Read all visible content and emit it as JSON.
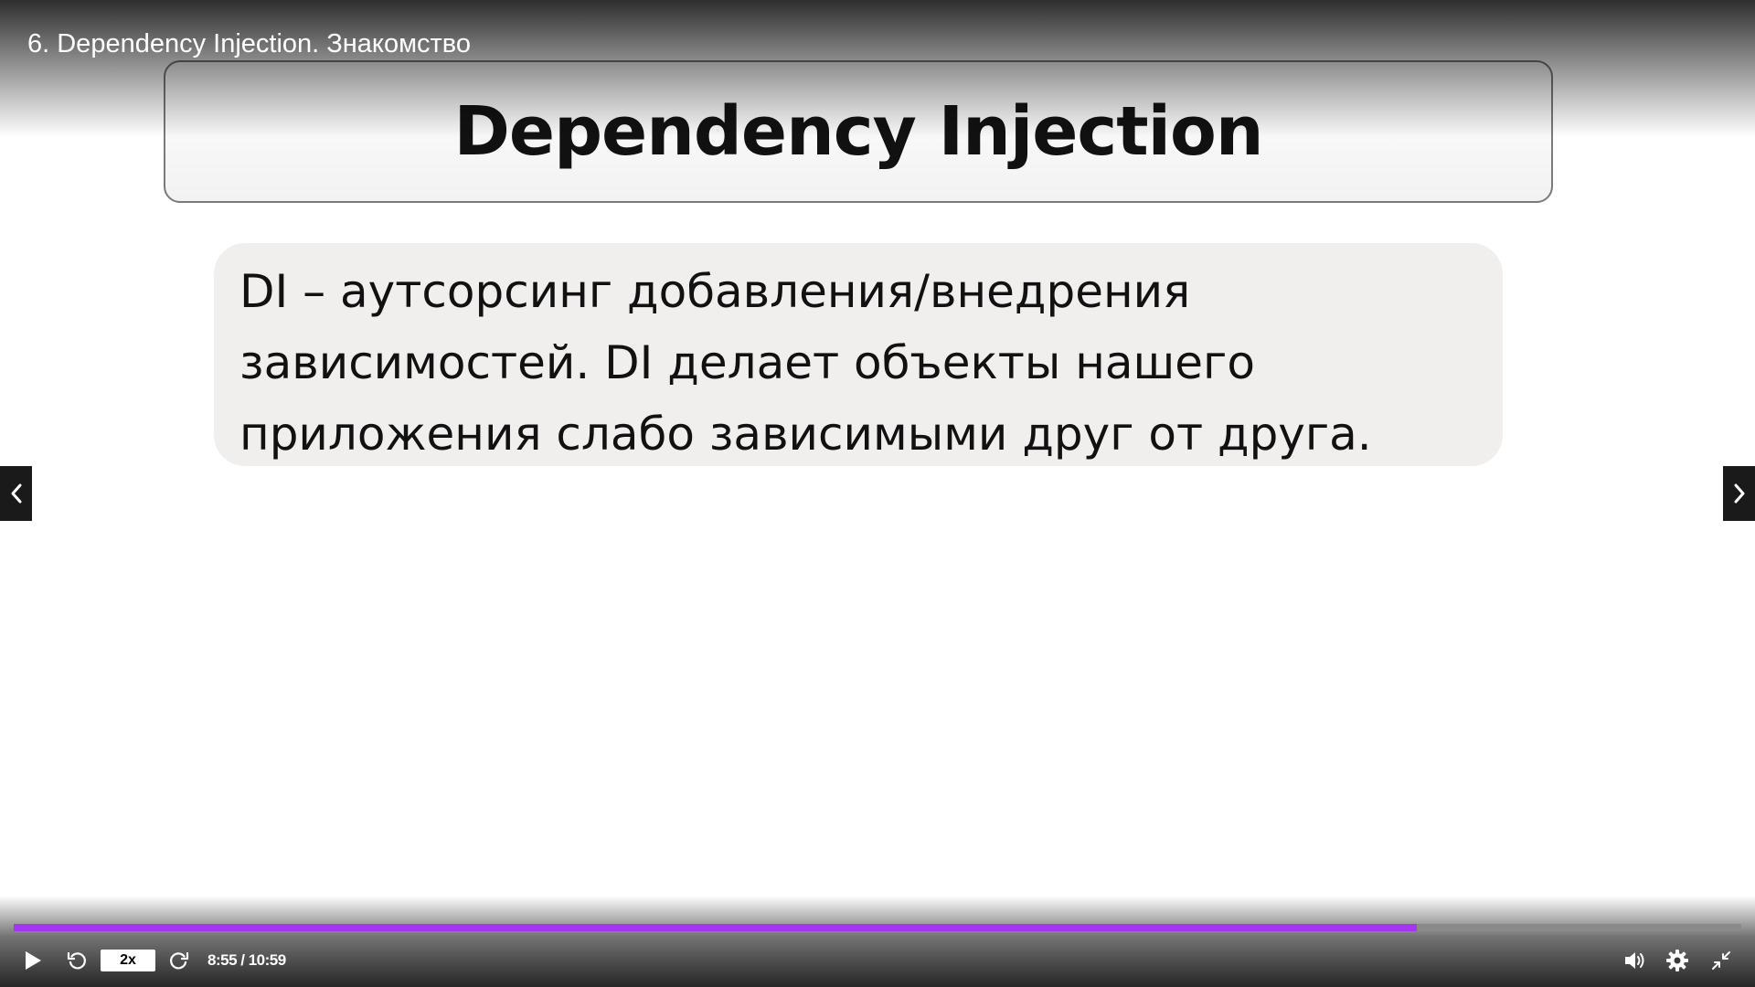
{
  "video": {
    "title": "6. Dependency Injection. Знакомство"
  },
  "slide": {
    "title": "Dependency Injection",
    "body_lines": [
      "DI – аутсорсинг добавления/внедрения",
      "зависимостей. DI делает объекты нашего",
      "приложения слабо зависимыми друг от друга."
    ]
  },
  "controls": {
    "speed_label": "2x",
    "current_time": "8:55",
    "separator": " / ",
    "duration": "10:59",
    "progress_percent": 81.2,
    "icons": {
      "play": "play-icon",
      "rewind": "rewind-icon",
      "forward": "forward-icon",
      "volume": "volume-icon",
      "settings": "gear-icon",
      "fullscreen": "exit-fullscreen-icon",
      "prev": "chevron-left-icon",
      "next": "chevron-right-icon"
    }
  },
  "colors": {
    "progress_accent": "#a435f0"
  }
}
